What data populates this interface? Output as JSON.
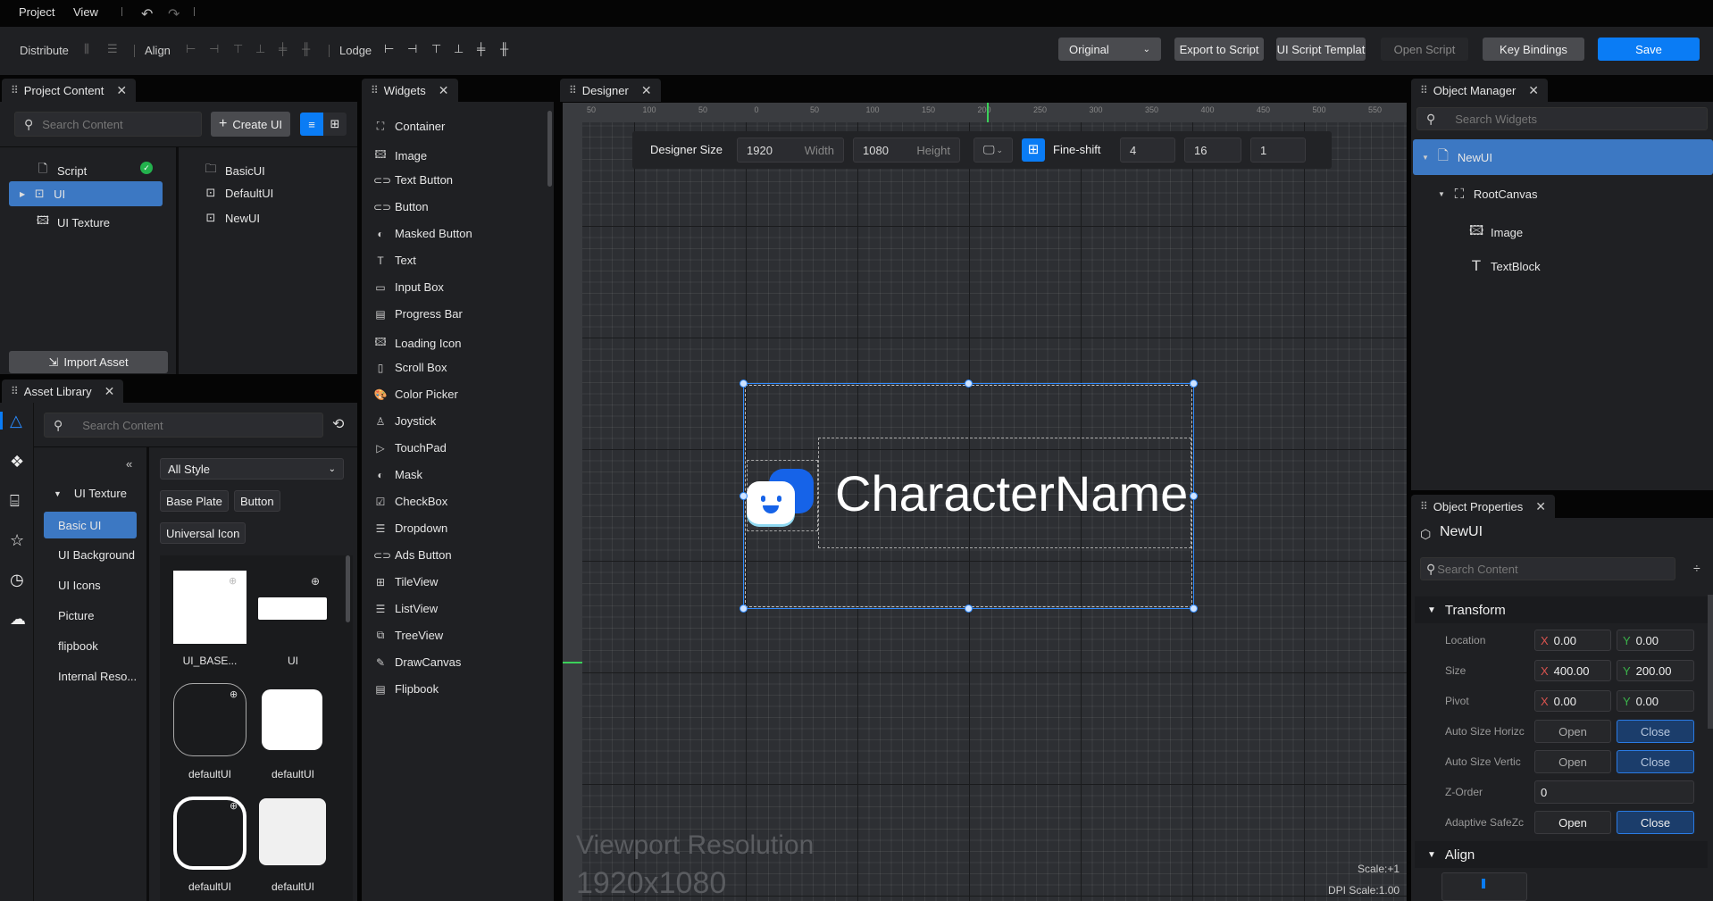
{
  "menu": {
    "items": [
      "Project",
      "View"
    ]
  },
  "toolbar": {
    "distribute_label": "Distribute",
    "align_label": "Align",
    "lodge_label": "Lodge",
    "mode_select": "Original",
    "export_script": "Export to Script",
    "ui_script_template": "UI Script Templat",
    "open_script": "Open Script",
    "key_bindings": "Key Bindings",
    "save": "Save"
  },
  "project_content": {
    "tab": "Project Content",
    "search_placeholder": "Search Content",
    "create_ui": "Create UI",
    "tree": [
      {
        "label": "Script",
        "icon": "file-icon",
        "status": "ok"
      },
      {
        "label": "UI",
        "icon": "ui-icon",
        "selected": true
      },
      {
        "label": "UI Texture",
        "icon": "texture-icon"
      }
    ],
    "files": [
      {
        "label": "BasicUI",
        "icon": "folder-icon"
      },
      {
        "label": "DefaultUI",
        "icon": "ui-icon"
      },
      {
        "label": "NewUI",
        "icon": "ui-icon"
      }
    ],
    "import_asset": "Import Asset"
  },
  "asset_library": {
    "tab": "Asset Library",
    "search_placeholder": "Search Content",
    "category_root": "UI Texture",
    "categories": [
      "Basic UI",
      "UI Background",
      "UI Icons",
      "Picture",
      "flipbook",
      "Internal Reso..."
    ],
    "style_select": "All Style",
    "chips": [
      "Base Plate",
      "Button",
      "Universal Icon"
    ],
    "assets": [
      "UI_BASE...",
      "UI",
      "defaultUI",
      "defaultUI",
      "defaultUI",
      "defaultUI"
    ]
  },
  "widgets": {
    "tab": "Widgets",
    "items": [
      "Container",
      "Image",
      "Text Button",
      "Button",
      "Masked Button",
      "Text",
      "Input Box",
      "Progress Bar",
      "Loading Icon",
      "Scroll Box",
      "Color Picker",
      "Joystick",
      "TouchPad",
      "Mask",
      "CheckBox",
      "Dropdown",
      "Ads Button",
      "TileView",
      "ListView",
      "TreeView",
      "DrawCanvas",
      "Flipbook"
    ]
  },
  "designer": {
    "tab": "Designer",
    "size_label": "Designer Size",
    "width_value": "1920",
    "width_hint": "Width",
    "height_value": "1080",
    "height_hint": "Height",
    "fine_shift_label": "Fine-shift",
    "fine_shift_values": [
      "4",
      "16",
      "1"
    ],
    "ruler_top": [
      "50",
      "100",
      "50",
      "0",
      "50",
      "100",
      "150",
      "200",
      "250",
      "300",
      "350",
      "400",
      "450",
      "500",
      "550"
    ],
    "canvas_text": "CharacterName",
    "viewport_label": "Viewport Resolution",
    "viewport_value": "1920x1080",
    "scale": "Scale:+1",
    "dpi_scale": "DPI Scale:1.00"
  },
  "object_manager": {
    "tab": "Object Manager",
    "search_placeholder": "Search Widgets",
    "tree": [
      {
        "label": "NewUI",
        "level": 0,
        "selected": true
      },
      {
        "label": "RootCanvas",
        "level": 1
      },
      {
        "label": "Image",
        "level": 2
      },
      {
        "label": "TextBlock",
        "level": 2
      }
    ]
  },
  "object_properties": {
    "tab": "Object Properties",
    "object_name": "NewUI",
    "search_placeholder": "Search Content",
    "transform_label": "Transform",
    "location": {
      "label": "Location",
      "x": "0.00",
      "y": "0.00"
    },
    "size": {
      "label": "Size",
      "x": "400.00",
      "y": "200.00"
    },
    "pivot": {
      "label": "Pivot",
      "x": "0.00",
      "y": "0.00"
    },
    "auto_size_h": {
      "label": "Auto Size Horizc",
      "open": "Open",
      "close": "Close"
    },
    "auto_size_v": {
      "label": "Auto Size Vertic",
      "open": "Open",
      "close": "Close"
    },
    "z_order": {
      "label": "Z-Order",
      "value": "0"
    },
    "adaptive_safe": {
      "label": "Adaptive SafeZc",
      "open": "Open",
      "close": "Close"
    },
    "align_label": "Align"
  },
  "colors": {
    "accent": "#0a7cf5",
    "selection": "#3c78c3",
    "panel": "#1f2023"
  }
}
